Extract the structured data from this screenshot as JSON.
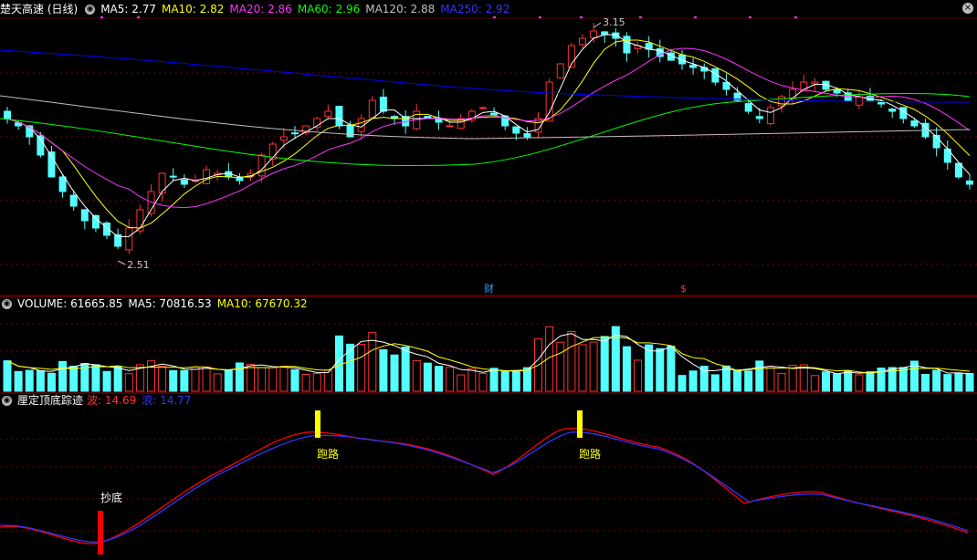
{
  "colors": {
    "up": "#ff3232",
    "down": "#54ffff",
    "ma5": "#ffffff",
    "ma10": "#ffff00",
    "ma20": "#ff33ff",
    "ma60": "#00ff00",
    "ma120": "#c0c0c0",
    "ma250": "#0000ff",
    "grid": "#7a0000",
    "signal_red": "#ff0000",
    "signal_blue": "#3333ff"
  },
  "main": {
    "stock_name": "楚天高速 (日线)",
    "ma_labels": [
      {
        "text": "MA5: 2.77",
        "color": "#ffffff"
      },
      {
        "text": "MA10: 2.82",
        "color": "#ffff00"
      },
      {
        "text": "MA20: 2.86",
        "color": "#ff33ff"
      },
      {
        "text": "MA60: 2.96",
        "color": "#00ff00"
      },
      {
        "text": "MA120: 2.88",
        "color": "#c0c0c0"
      },
      {
        "text": "MA250: 2.92",
        "color": "#3333ff"
      }
    ],
    "high_label": "3.15",
    "low_label": "2.51",
    "event_cai": "财",
    "event_dollar": "$",
    "close_icon": "close-icon"
  },
  "volume": {
    "labels": [
      {
        "text": "VOLUME: 61665.85",
        "color": "#ffffff"
      },
      {
        "text": "MA5: 70816.53",
        "color": "#ffffff"
      },
      {
        "text": "MA10: 67670.32",
        "color": "#ffff00"
      }
    ]
  },
  "indicator": {
    "title": "厘定顶底踪迹",
    "labels": [
      {
        "text": "波: 14.69",
        "color": "#ff3232"
      },
      {
        "text": "浪: 14.77",
        "color": "#3333ff"
      }
    ],
    "signal_buy": "抄底",
    "signal_sell_1": "跑路",
    "signal_sell_2": "跑路"
  }
}
